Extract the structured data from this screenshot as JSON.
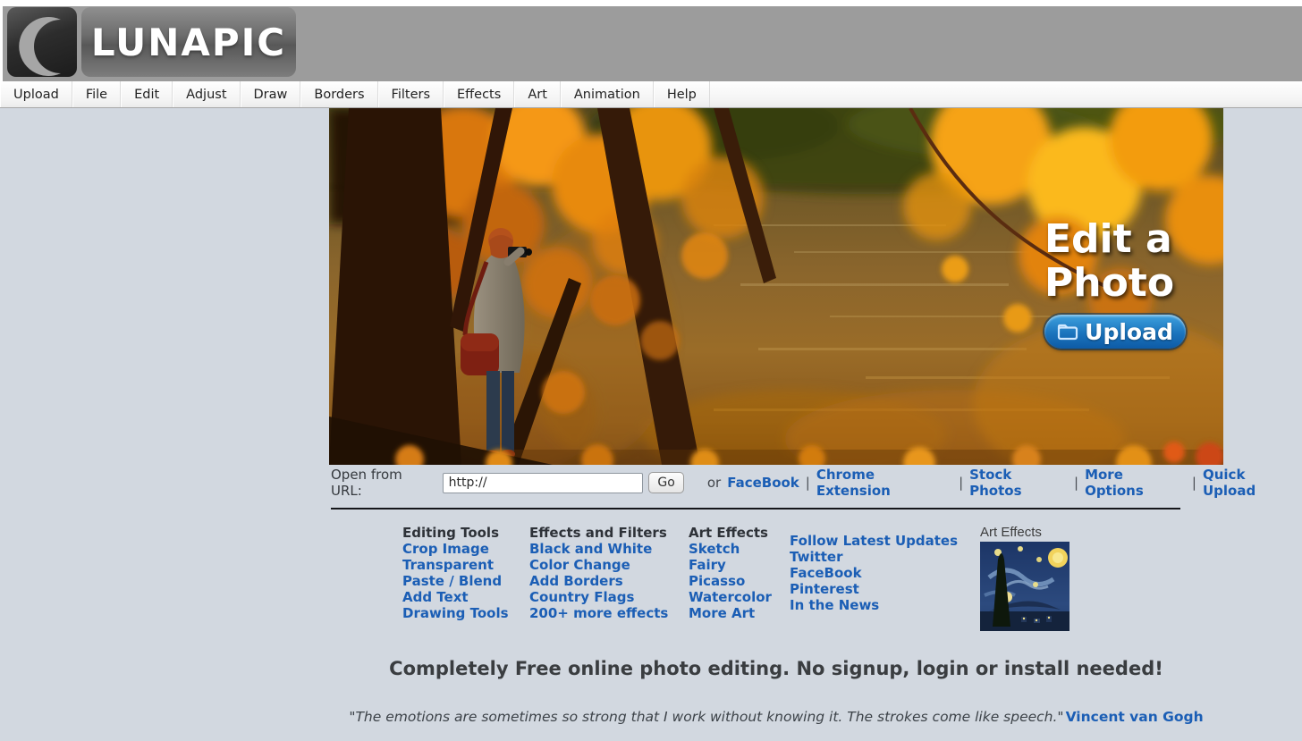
{
  "banner": {
    "logo_text": "LUNAPIC"
  },
  "menu": {
    "items": [
      "Upload",
      "File",
      "Edit",
      "Adjust",
      "Draw",
      "Borders",
      "Filters",
      "Effects",
      "Art",
      "Animation",
      "Help"
    ]
  },
  "hero": {
    "headline_line1": "Edit a",
    "headline_line2": "Photo",
    "upload_button_label": "Upload"
  },
  "url_bar": {
    "label": "Open from URL:",
    "input_value": "http://",
    "go_button_label": "Go",
    "or_text": "or",
    "separator": "|",
    "links": [
      "FaceBook",
      "Chrome Extension",
      "Stock Photos",
      "More Options",
      "Quick Upload"
    ]
  },
  "columns": [
    {
      "header": "Editing Tools",
      "links": [
        "Crop Image",
        "Transparent",
        "Paste / Blend",
        "Add Text",
        "Drawing Tools"
      ]
    },
    {
      "header": "Effects and Filters",
      "links": [
        "Black and White",
        "Color Change",
        "Add Borders",
        "Country Flags",
        "200+ more effects"
      ]
    },
    {
      "header": "Art Effects",
      "links": [
        "Sketch",
        "Fairy",
        "Picasso",
        "Watercolor",
        "More Art"
      ]
    },
    {
      "header": "Follow Latest Updates",
      "links": [
        "Twitter",
        "FaceBook",
        "Pinterest",
        "In the News"
      ]
    }
  ],
  "thumbnail": {
    "label": "Art Effects"
  },
  "tagline": "Completely Free online photo editing. No signup, login or install needed!",
  "quote": {
    "text": "\"The emotions are sometimes so strong that I work without knowing it. The strokes come like speech.\"",
    "author": "Vincent van Gogh"
  },
  "colors": {
    "page_background": "#d2d8e0",
    "banner_gray": "#9c9c9c",
    "link_blue": "#1b5eb5",
    "upload_button_blue": "#1b74bd",
    "divider_dark": "#15161a"
  }
}
